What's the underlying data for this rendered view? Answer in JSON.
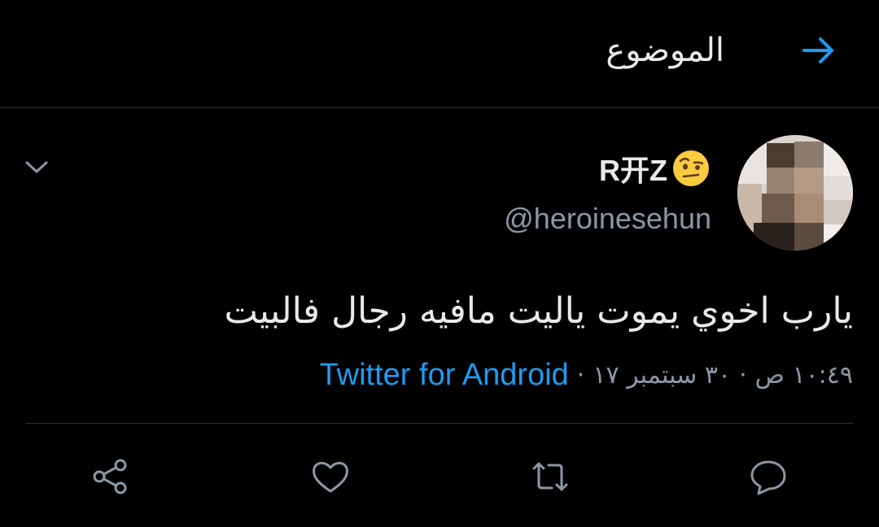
{
  "header": {
    "title": "الموضوع",
    "back_icon": "arrow-right-icon",
    "accent": "#1d9bf0"
  },
  "tweet": {
    "display_name": "R开Z",
    "name_emoji": "face-with-raised-eyebrow-emoji",
    "handle": "@heroinesehun",
    "text": "يارب اخوي يموت ياليت مافيه رجال فالبيت",
    "time": "١٠:٤٩ ص",
    "date": "٣٠ سبتمبر ١٧",
    "separator": "·",
    "source": "Twitter for Android",
    "menu_icon": "chevron-down-icon"
  },
  "actions": [
    {
      "name": "reply",
      "icon": "reply-icon"
    },
    {
      "name": "retweet",
      "icon": "retweet-icon"
    },
    {
      "name": "like",
      "icon": "heart-icon"
    },
    {
      "name": "share",
      "icon": "share-icon"
    }
  ],
  "colors": {
    "background": "#000000",
    "text": "#e7e9ea",
    "secondary": "#8b98a5",
    "link": "#1d9bf0"
  }
}
